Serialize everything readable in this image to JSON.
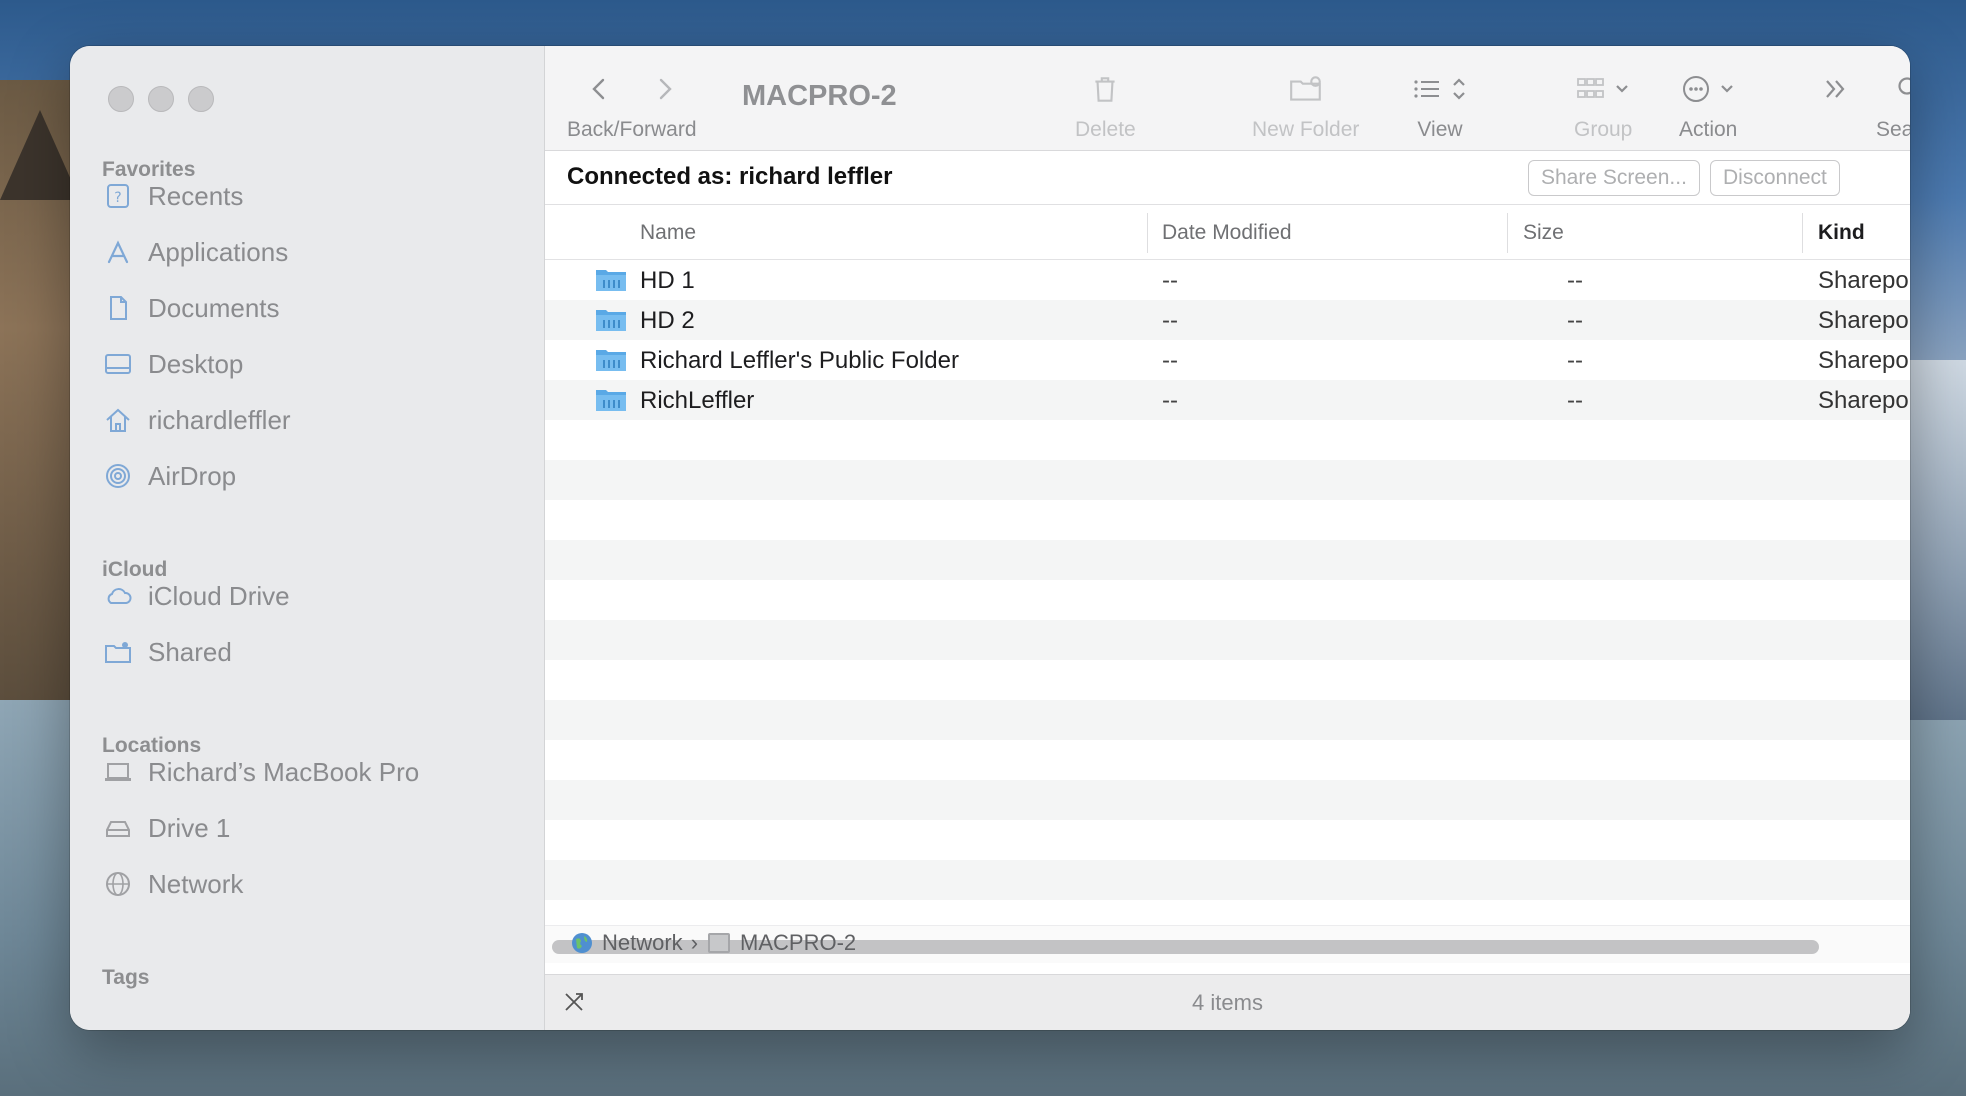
{
  "window": {
    "title": "MACPRO-2"
  },
  "sidebar": {
    "sections": [
      {
        "heading": "Favorites",
        "items": [
          {
            "label": "Recents",
            "icon": "recents-icon"
          },
          {
            "label": "Applications",
            "icon": "applications-icon"
          },
          {
            "label": "Documents",
            "icon": "documents-icon"
          },
          {
            "label": "Desktop",
            "icon": "desktop-icon"
          },
          {
            "label": "richardleffler",
            "icon": "home-icon"
          },
          {
            "label": "AirDrop",
            "icon": "airdrop-icon"
          }
        ]
      },
      {
        "heading": "iCloud",
        "items": [
          {
            "label": "iCloud Drive",
            "icon": "icloud-icon"
          },
          {
            "label": "Shared",
            "icon": "shared-folder-icon"
          }
        ]
      },
      {
        "heading": "Locations",
        "items": [
          {
            "label": "Richard’s MacBook Pro",
            "icon": "laptop-icon"
          },
          {
            "label": "Drive 1",
            "icon": "drive-icon"
          },
          {
            "label": "Network",
            "icon": "network-icon"
          }
        ]
      },
      {
        "heading": "Tags",
        "items": []
      }
    ]
  },
  "toolbar": {
    "back_forward": "Back/Forward",
    "delete": "Delete",
    "new_folder": "New Folder",
    "view": "View",
    "group": "Group",
    "action": "Action",
    "search": "Search"
  },
  "connection": {
    "text": "Connected as: richard leffler",
    "share_screen": "Share Screen...",
    "disconnect": "Disconnect"
  },
  "table": {
    "columns": {
      "name": "Name",
      "date": "Date Modified",
      "size": "Size",
      "kind": "Kind"
    },
    "rows": [
      {
        "name": "HD 1",
        "date": "--",
        "size": "--",
        "kind": "Sharepoint"
      },
      {
        "name": "HD 2",
        "date": "--",
        "size": "--",
        "kind": "Sharepoint"
      },
      {
        "name": "Richard Leffler's Public Folder",
        "date": "--",
        "size": "--",
        "kind": "Sharepoint"
      },
      {
        "name": "RichLeffler",
        "date": "--",
        "size": "--",
        "kind": "Sharepoint"
      }
    ]
  },
  "path": {
    "root": "Network",
    "separator": "›",
    "current": "MACPRO-2"
  },
  "status": {
    "items": "4 items"
  },
  "colors": {
    "folder": "#5aa9e6",
    "accent": "#1d1d1f"
  }
}
